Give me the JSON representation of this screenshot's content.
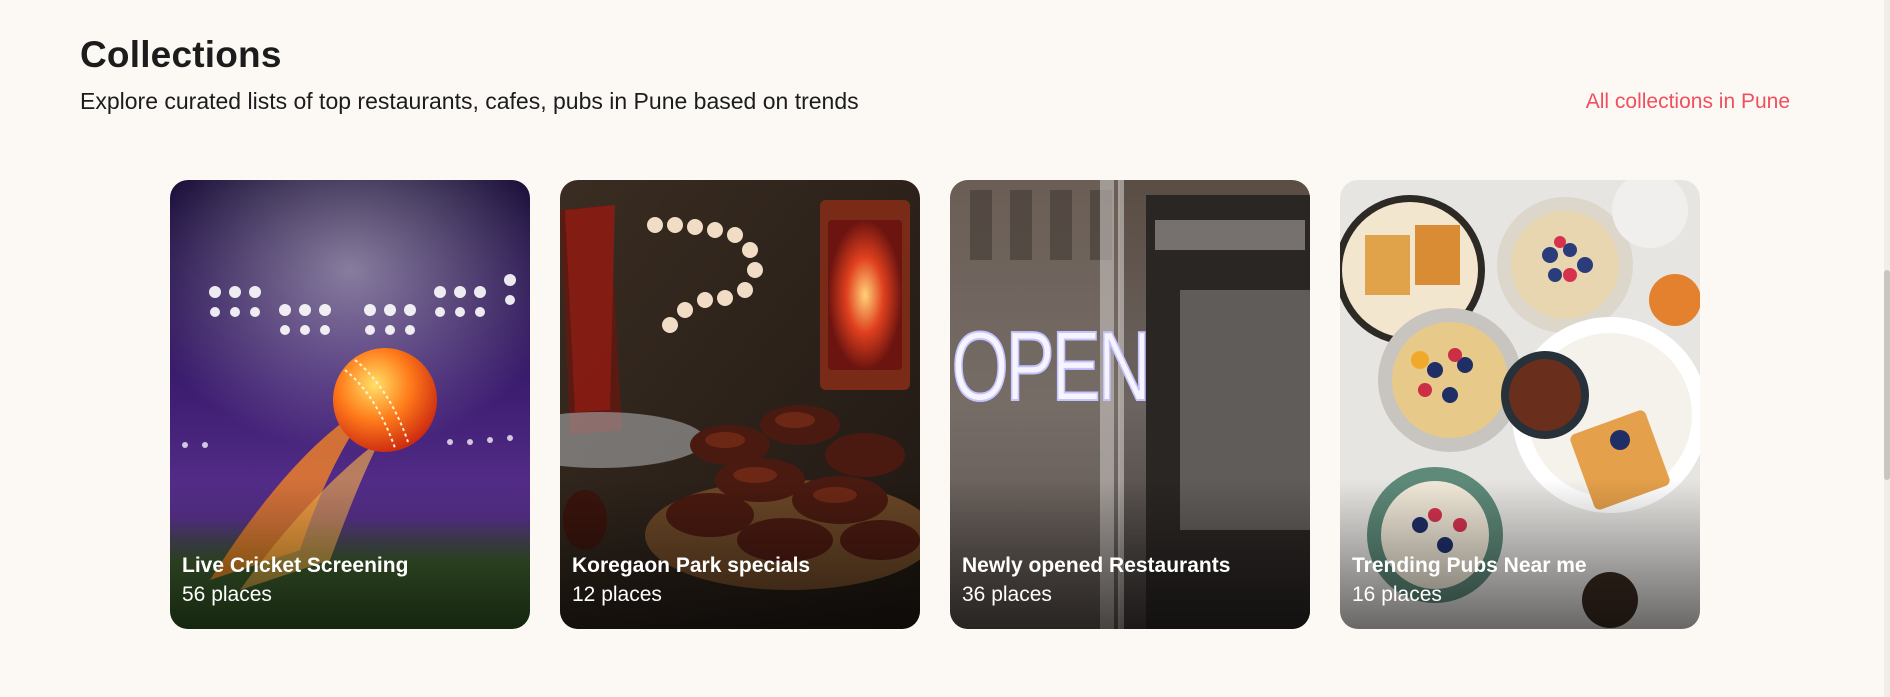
{
  "section": {
    "title": "Collections",
    "subtitle": "Explore curated lists of top restaurants, cafes, pubs in Pune based on trends",
    "all_link": "All collections in Pune"
  },
  "cards": [
    {
      "title": "Live Cricket Screening",
      "count": "56 places"
    },
    {
      "title": "Koregaon Park specials",
      "count": "12 places"
    },
    {
      "title": "Newly opened Restaurants",
      "count": "36 places"
    },
    {
      "title": "Trending Pubs Near me",
      "count": "16 places"
    }
  ],
  "images": {
    "card_0_sign": "",
    "card_2_sign": "OPEN"
  },
  "colors": {
    "background": "#fcf9f4",
    "accent": "#ef4f5f",
    "heading": "#1c1c1c"
  }
}
